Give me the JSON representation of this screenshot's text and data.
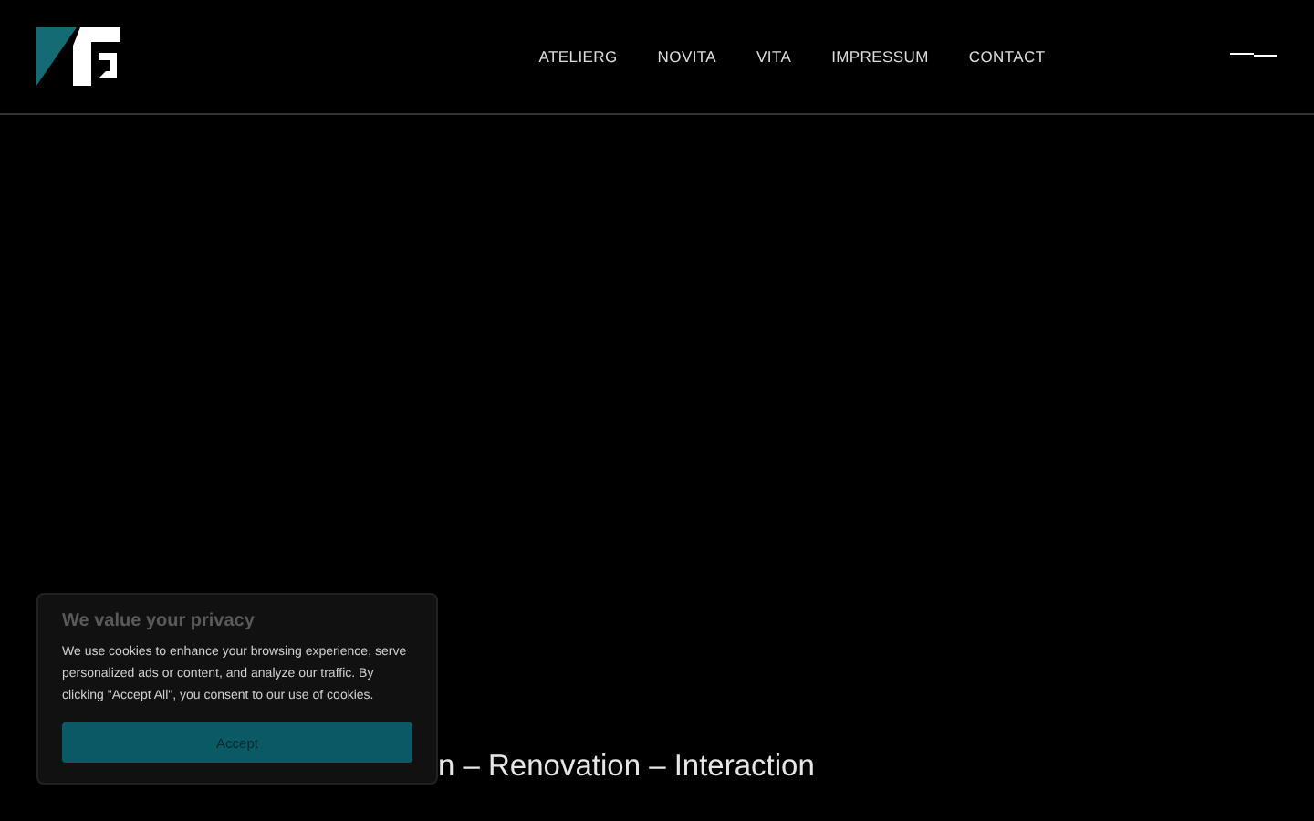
{
  "header": {
    "nav": [
      {
        "label": "ATELIERG"
      },
      {
        "label": "NOVITA"
      },
      {
        "label": "VITA"
      },
      {
        "label": "IMPRESSUM"
      },
      {
        "label": "CONTACT"
      }
    ]
  },
  "hero": {
    "tagline": "n – Renovation – Interaction"
  },
  "cookie_banner": {
    "title": "We value your privacy",
    "text": "We use cookies to enhance your browsing experience, serve personalized ads or content, and analyze our traffic. By clicking \"Accept All\", you consent to our use of cookies.",
    "button": "Accept"
  }
}
